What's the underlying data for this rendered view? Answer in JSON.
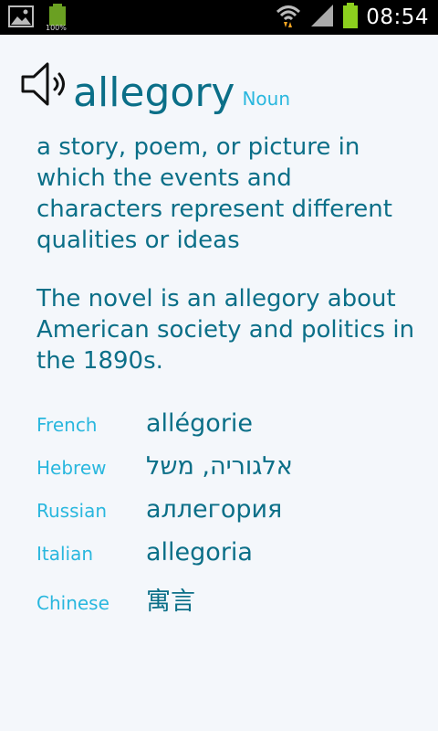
{
  "status_bar": {
    "battery_percent_label": "100%",
    "time": "08:54"
  },
  "entry": {
    "headword": "allegory",
    "part_of_speech": "Noun",
    "definition": "a story, poem, or picture in which the events and characters represent different qualities or ideas",
    "example": "The novel is an allegory about American society and politics in the 1890s."
  },
  "translations": [
    {
      "language": "French",
      "word": "allégorie"
    },
    {
      "language": "Hebrew",
      "word": "אלגוריה, משל"
    },
    {
      "language": "Russian",
      "word": "аллегория"
    },
    {
      "language": "Italian",
      "word": "allegoria"
    },
    {
      "language": "Chinese",
      "word": "寓言"
    }
  ],
  "colors": {
    "primary_text": "#0b6f88",
    "accent_text": "#29b7de",
    "background": "#f4f7fb",
    "status_bar": "#000000",
    "battery_green": "#8ccf1e"
  },
  "icons": [
    "gallery-icon",
    "battery-charging-icon",
    "wifi-icon",
    "signal-icon",
    "battery-icon",
    "speaker-icon"
  ]
}
